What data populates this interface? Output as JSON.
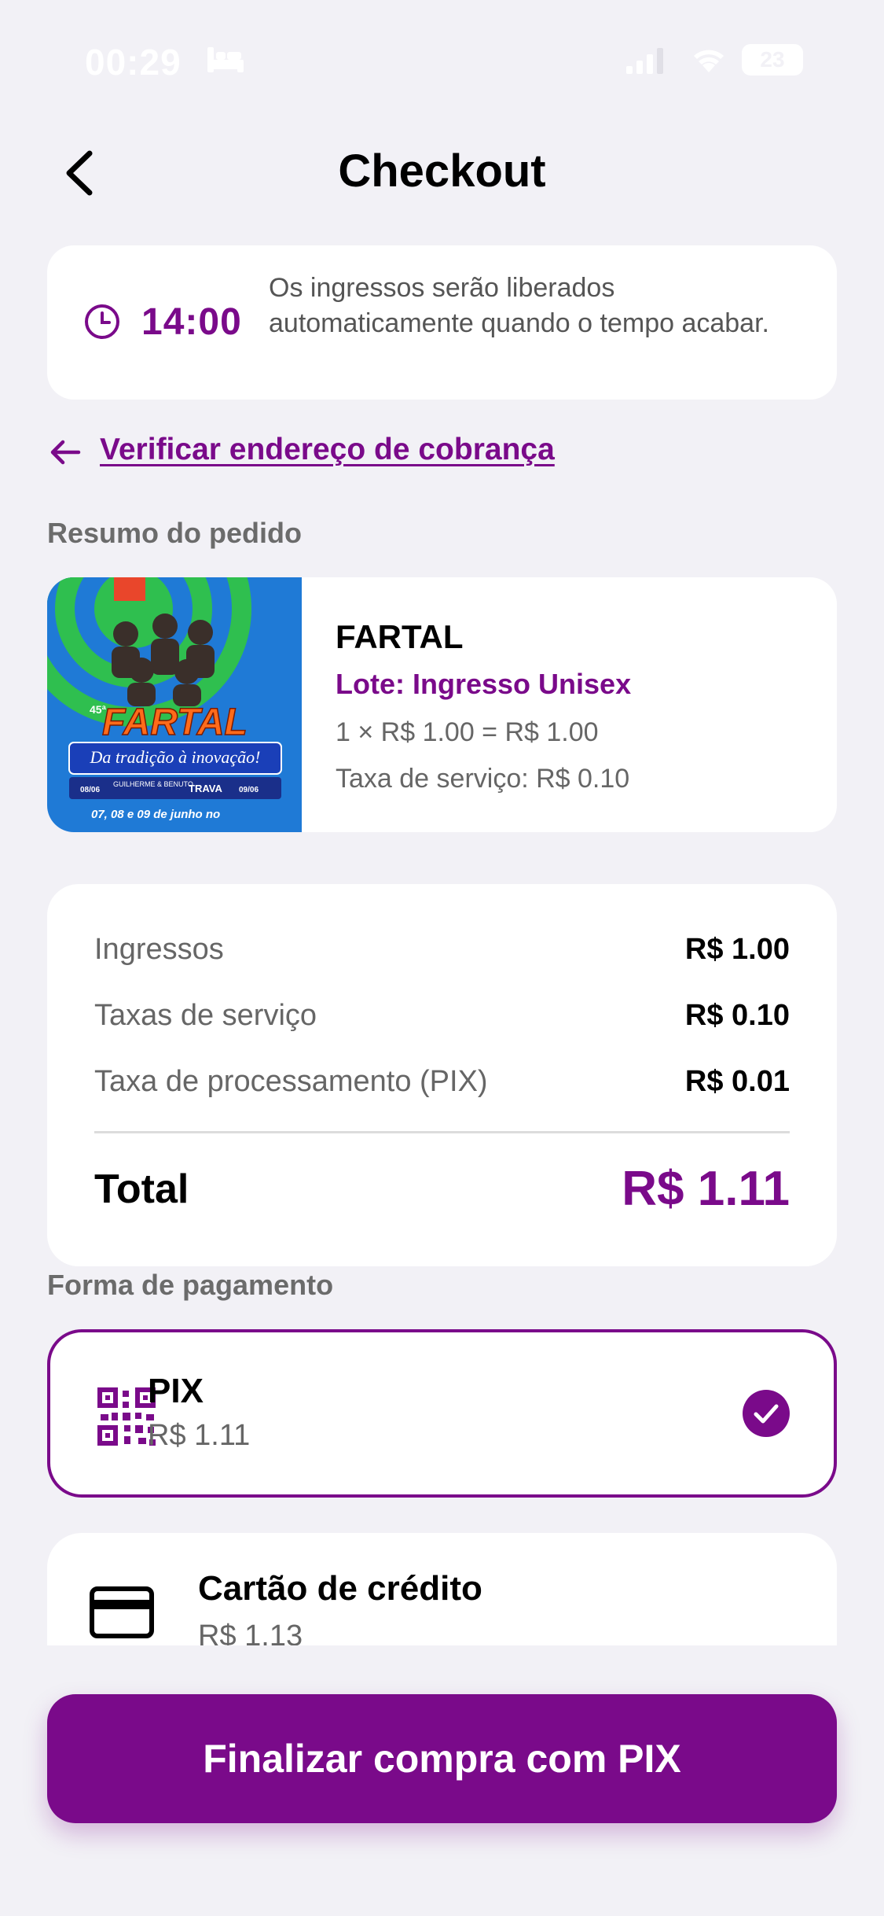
{
  "status_bar": {
    "time": "00:29",
    "battery": "23"
  },
  "header": {
    "title": "Checkout"
  },
  "timer": {
    "value": "14:00",
    "message": "Os ingressos serão liberados automaticamente quando o tempo acabar."
  },
  "billing_link": "Verificar endereço de cobrança",
  "order": {
    "section_label": "Resumo do pedido",
    "event_name": "FARTAL",
    "lot": "Lote: Ingresso Unisex",
    "calc": "1 × R$ 1.00 = R$ 1.00",
    "service_fee": "Taxa de serviço: R$ 0.10",
    "poster": {
      "edition": "45ª",
      "title": "FARTAL",
      "tagline": "Da tradição à inovação!",
      "date_left": "08/06",
      "artist_left": "GUILHERME & BENUTO",
      "artist_right": "TRAVA",
      "date_right": "09/06",
      "dates": "07, 08 e 09 de junho no"
    }
  },
  "summary": {
    "rows": [
      {
        "label": "Ingressos",
        "value": "R$ 1.00"
      },
      {
        "label": "Taxas de serviço",
        "value": "R$ 0.10"
      },
      {
        "label": "Taxa de processamento (PIX)",
        "value": "R$ 0.01"
      }
    ],
    "total_label": "Total",
    "total_value": "R$ 1.11"
  },
  "payment": {
    "section_label": "Forma de pagamento",
    "options": [
      {
        "name": "PIX",
        "price": "R$ 1.11",
        "selected": true,
        "icon": "qr-code-icon"
      },
      {
        "name": "Cartão de crédito",
        "price": "R$ 1.13",
        "selected": false,
        "icon": "credit-card-icon"
      }
    ]
  },
  "cta": {
    "label": "Finalizar compra com PIX"
  },
  "colors": {
    "accent": "#7a0a8a",
    "background": "#f2f1f6",
    "card": "#ffffff"
  }
}
